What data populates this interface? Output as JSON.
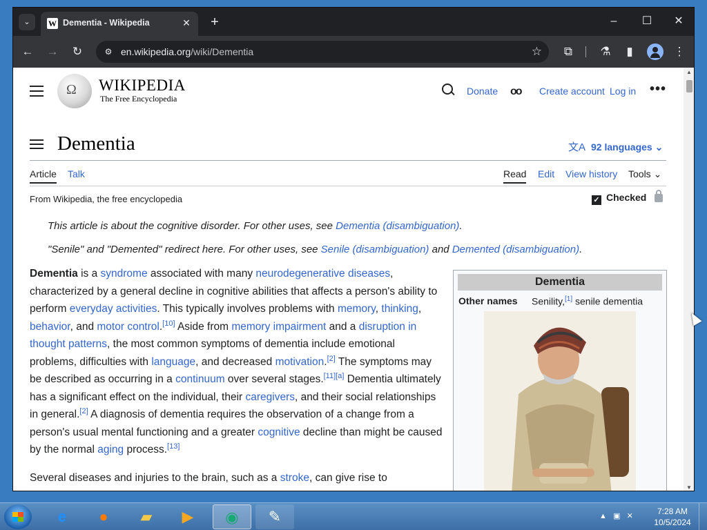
{
  "browser": {
    "tab_title": "Dementia - Wikipedia",
    "url_domain": "en.wikipedia.org",
    "url_path": "/wiki/Dementia"
  },
  "header": {
    "wordmark": "WIKIPEDIA",
    "tagline": "The Free Encyclopedia",
    "donate": "Donate",
    "create_account": "Create account",
    "login": "Log in"
  },
  "article": {
    "title": "Dementia",
    "languages": "92 languages",
    "tabs_left": [
      "Article",
      "Talk"
    ],
    "tabs_right": [
      "Read",
      "Edit",
      "View history",
      "Tools"
    ],
    "from": "From Wikipedia, the free encyclopedia",
    "checked": "Checked",
    "hatnote1_text": "This article is about the cognitive disorder. For other uses, see ",
    "hatnote1_link": "Dementia (disambiguation)",
    "hatnote2_text_a": "\"Senile\" and \"Demented\" redirect here. For other uses, see ",
    "hatnote2_link1": "Senile (disambiguation)",
    "hatnote2_and": " and ",
    "hatnote2_link2": "Demented (disambiguation)",
    "lead_second_para_start": "Several diseases and injuries to the brain, such as a ",
    "lead_second_para_link": "stroke",
    "lead_second_para_end": ", can give rise to"
  },
  "infobox": {
    "title": "Dementia",
    "label_other_names": "Other names",
    "value_other_names_a": "Senility,",
    "value_other_names_ref": "[1]",
    "value_other_names_b": " senile dementia"
  },
  "taskbar": {
    "time": "7:28 AM",
    "date": "10/5/2024"
  },
  "icons": [
    "chevron-down-icon",
    "wikipedia-favicon-icon",
    "close-icon",
    "plus-icon",
    "minimize-icon",
    "maximize-icon",
    "back-icon",
    "forward-icon",
    "reload-icon",
    "site-info-icon",
    "star-icon",
    "extensions-icon",
    "labs-icon",
    "sidepanel-icon",
    "profile-icon",
    "kebab-icon",
    "hamburger-icon",
    "search-icon",
    "glasses-icon",
    "toc-icon",
    "translate-icon",
    "lock-icon"
  ]
}
